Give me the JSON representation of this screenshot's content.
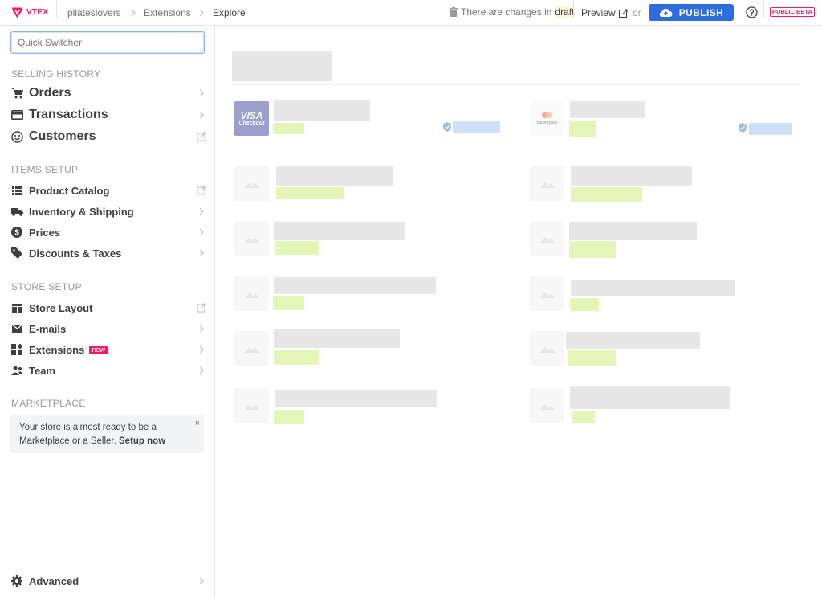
{
  "topbar": {
    "brand": "VTEX",
    "breadcrumb": [
      "pilateslovers",
      "Extensions",
      "Explore"
    ],
    "changes_text": "There are changes in",
    "draft_word": "draft",
    "preview_label": "Preview",
    "or_label": "or",
    "publish_label": "PUBLISH",
    "beta_label": "PUBLIC BETA"
  },
  "sidebar": {
    "quick_switcher_placeholder": "Quick Switcher",
    "selling_history_title": "SELLING HISTORY",
    "orders": "Orders",
    "transactions": "Transactions",
    "customers": "Customers",
    "items_setup_title": "ITEMS SETUP",
    "product_catalog": "Product Catalog",
    "inventory_shipping": "Inventory & Shipping",
    "prices": "Prices",
    "discounts_taxes": "Discounts & Taxes",
    "store_setup_title": "STORE SETUP",
    "store_layout": "Store Layout",
    "emails": "E-mails",
    "extensions": "Extensions",
    "extensions_badge": "new",
    "team": "Team",
    "marketplace_title": "MARKETPLACE",
    "marketplace_text": "Your store is almost ready to be a Marketplace or a Seller.",
    "marketplace_link": "Setup now",
    "marketplace_close": "×",
    "advanced": "Advanced"
  },
  "featured": {
    "visa_line1": "VISA",
    "visa_line2": "Checkout",
    "masterpass_label": "masterpass"
  },
  "colors": {
    "brand": "#f71963",
    "publish": "#2d6edf",
    "skeleton": "#e7e7e7",
    "skeleton_green": "#e4f5b8",
    "skeleton_blue": "#cfe0f8"
  }
}
